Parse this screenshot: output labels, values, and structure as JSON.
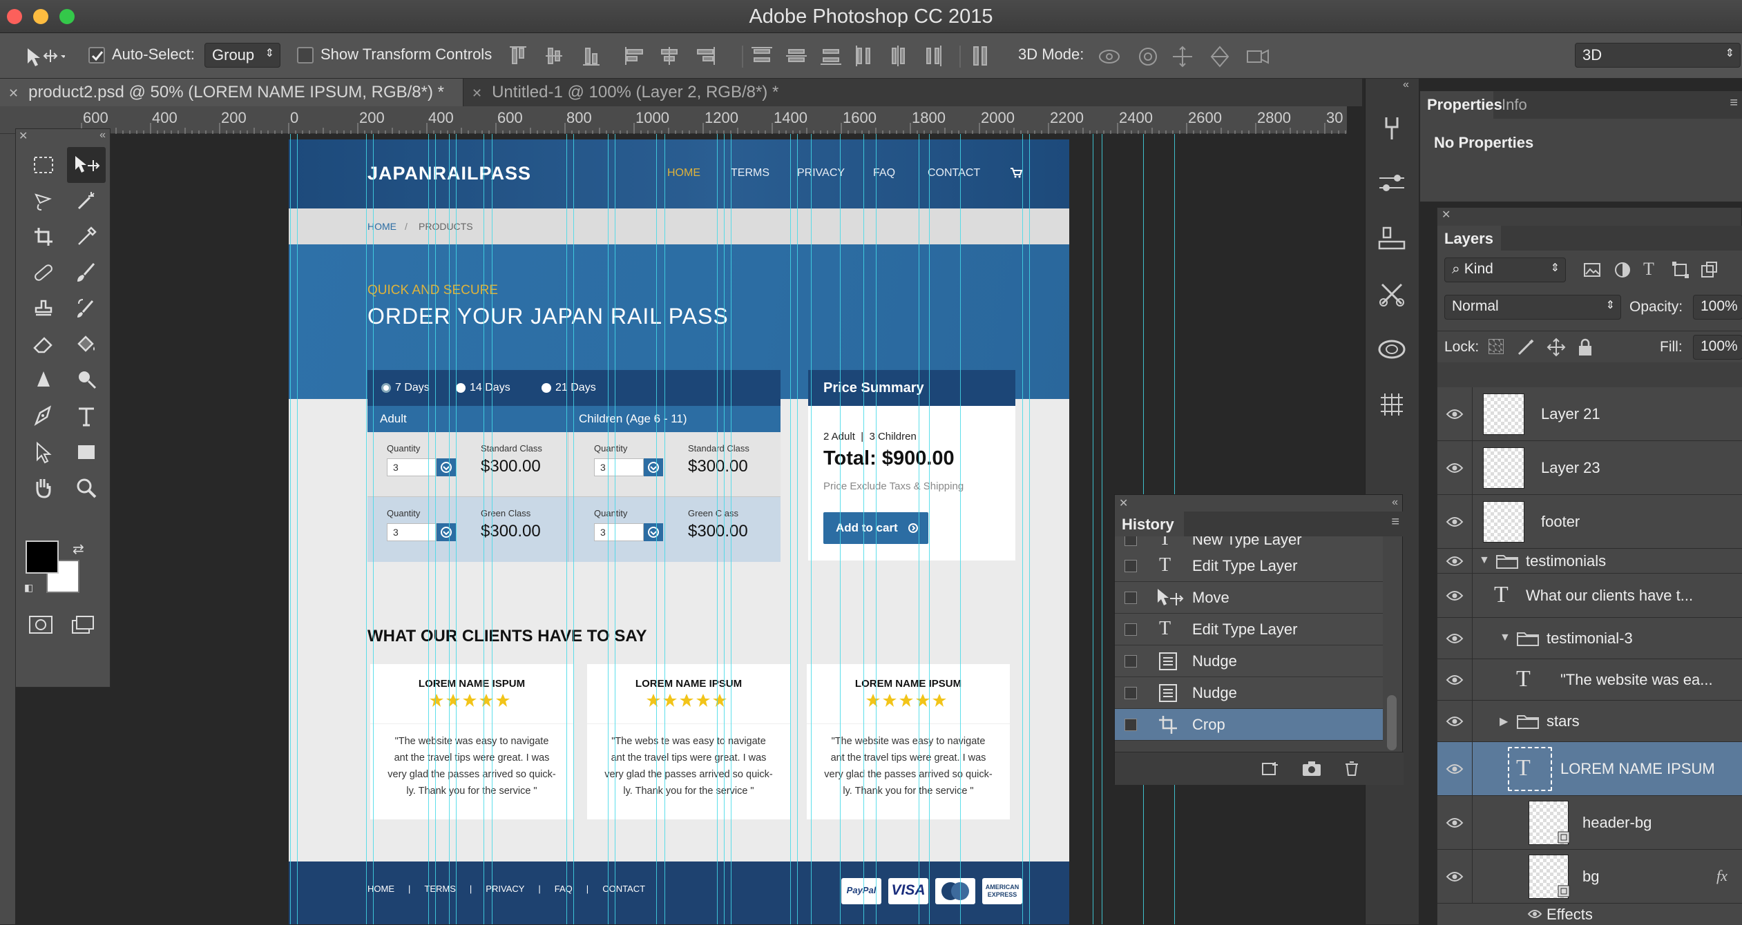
{
  "window": {
    "title": "Adobe Photoshop CC 2015"
  },
  "options_bar": {
    "auto_select_label": "Auto-Select:",
    "auto_select_value": "Group",
    "show_transform_label": "Show Transform Controls",
    "mode_3d_label": "3D Mode:",
    "workspace_value": "3D"
  },
  "tabs": [
    {
      "label": "product2.psd @ 50% (LOREM NAME IPSUM, RGB/8*) *",
      "active": true
    },
    {
      "label": "Untitled-1 @ 100% (Layer 2, RGB/8*) *",
      "active": false
    }
  ],
  "ruler": {
    "labels": [
      "600",
      "400",
      "200",
      "0",
      "200",
      "400",
      "600",
      "800",
      "1000",
      "1200",
      "1400",
      "1600",
      "1800",
      "2000",
      "2200",
      "2400",
      "2600",
      "2800",
      "30"
    ]
  },
  "document": {
    "logo": "JAPANRAILPASS",
    "nav": [
      "HOME",
      "TERMS",
      "PRIVACY",
      "FAQ",
      "CONTACT"
    ],
    "breadcrumb": {
      "home": "HOME",
      "sep": "/",
      "current": "PRODUCTS"
    },
    "hero": {
      "kicker": "QUICK AND SECURE",
      "title": "ORDER YOUR JAPAN RAIL PASS"
    },
    "durations": [
      "7 Days",
      "14 Days",
      "21 Days"
    ],
    "table": {
      "adult_header": "Adult",
      "children_header": "Children (Age 6 - 11)",
      "rows": [
        {
          "qty_label": "Quantity",
          "qty": "3",
          "class_label": "Standard Class",
          "price": "$300.00",
          "qty_label2": "Quantity",
          "qty2": "3",
          "class_label2": "Standard Class",
          "price2": "$300.00"
        },
        {
          "qty_label": "Quantity",
          "qty": "3",
          "class_label": "Green Class",
          "price": "$300.00",
          "qty_label2": "Quantity",
          "qty2": "3",
          "class_label2": "Green C ass",
          "price2": "$300.00"
        }
      ]
    },
    "summary": {
      "title": "Price Summary",
      "counts": "2 Adult  |  3 Children",
      "total": "Total: $900.00",
      "note": "Price Exclude Taxs & Shipping",
      "button": "Add to cart"
    },
    "testimonials_title": "WHAT OUR CLIENTS HAVE TO SAY",
    "testimonials": [
      {
        "name": "LOREM NAME ISPUM",
        "stars": 5,
        "text": [
          "\"The website was easy to navigate",
          "ant the travel tips were great. I was",
          "very glad the passes arrived so quick-",
          "ly. Thank you for the service \""
        ]
      },
      {
        "name": "LOREM NAME IPSUM",
        "stars": 5,
        "text": [
          "\"The webs te was easy to navigate",
          "ant the travel tips were great. I was",
          "very glad the passes arrived so quick-",
          "ly. Thank you for the service \""
        ]
      },
      {
        "name": "LOREM NAME IPSUM",
        "stars": 5,
        "text": [
          "\"The website was easy to navigate",
          "ant the travel tips were great. I was",
          "very glad the passes arrived so quick-",
          "ly. Thank you for the service \""
        ]
      }
    ],
    "footer_links": [
      "HOME",
      "|",
      "TERMS",
      "|",
      "PRIVACY",
      "|",
      "FAQ",
      "|",
      "CONTACT"
    ],
    "payments": [
      "PayPal",
      "VISA",
      "MasterCard",
      "AMERICAN EXPRESS"
    ]
  },
  "properties": {
    "tabs": [
      "Properties",
      "Info"
    ],
    "content": "No Properties"
  },
  "layers": {
    "title": "Layers",
    "filter": "Kind",
    "blend": "Normal",
    "opacity_label": "Opacity:",
    "opacity": "100%",
    "lock_label": "Lock:",
    "fill_label": "Fill:",
    "fill": "100%",
    "items": [
      {
        "name": "Layer 21",
        "type": "pixel"
      },
      {
        "name": "Layer 23",
        "type": "pixel"
      },
      {
        "name": "footer",
        "type": "pixel"
      },
      {
        "name": "testimonials",
        "type": "group"
      },
      {
        "name": "What our clients have t...",
        "type": "text"
      },
      {
        "name": "testimonial-3",
        "type": "group"
      },
      {
        "name": "\"The website was ea...",
        "type": "text"
      },
      {
        "name": "stars",
        "type": "group"
      },
      {
        "name": "LOREM NAME IPSUM",
        "type": "text",
        "selected": true
      },
      {
        "name": "header-bg",
        "type": "smart"
      },
      {
        "name": "bg",
        "type": "smart",
        "fx": "fx"
      }
    ],
    "effects_label": "Effects"
  },
  "history": {
    "title": "History",
    "items": [
      "New Type Layer",
      "Edit Type Layer",
      "Move",
      "Edit Type Layer",
      "Nudge",
      "Nudge",
      "Crop"
    ],
    "selected": "Crop"
  },
  "colors": {
    "accent_blue": "#2c6da3",
    "navy": "#1c4677",
    "gold": "#e0b33a",
    "guide": "#43d9e8",
    "selection": "#5b7a9b"
  }
}
